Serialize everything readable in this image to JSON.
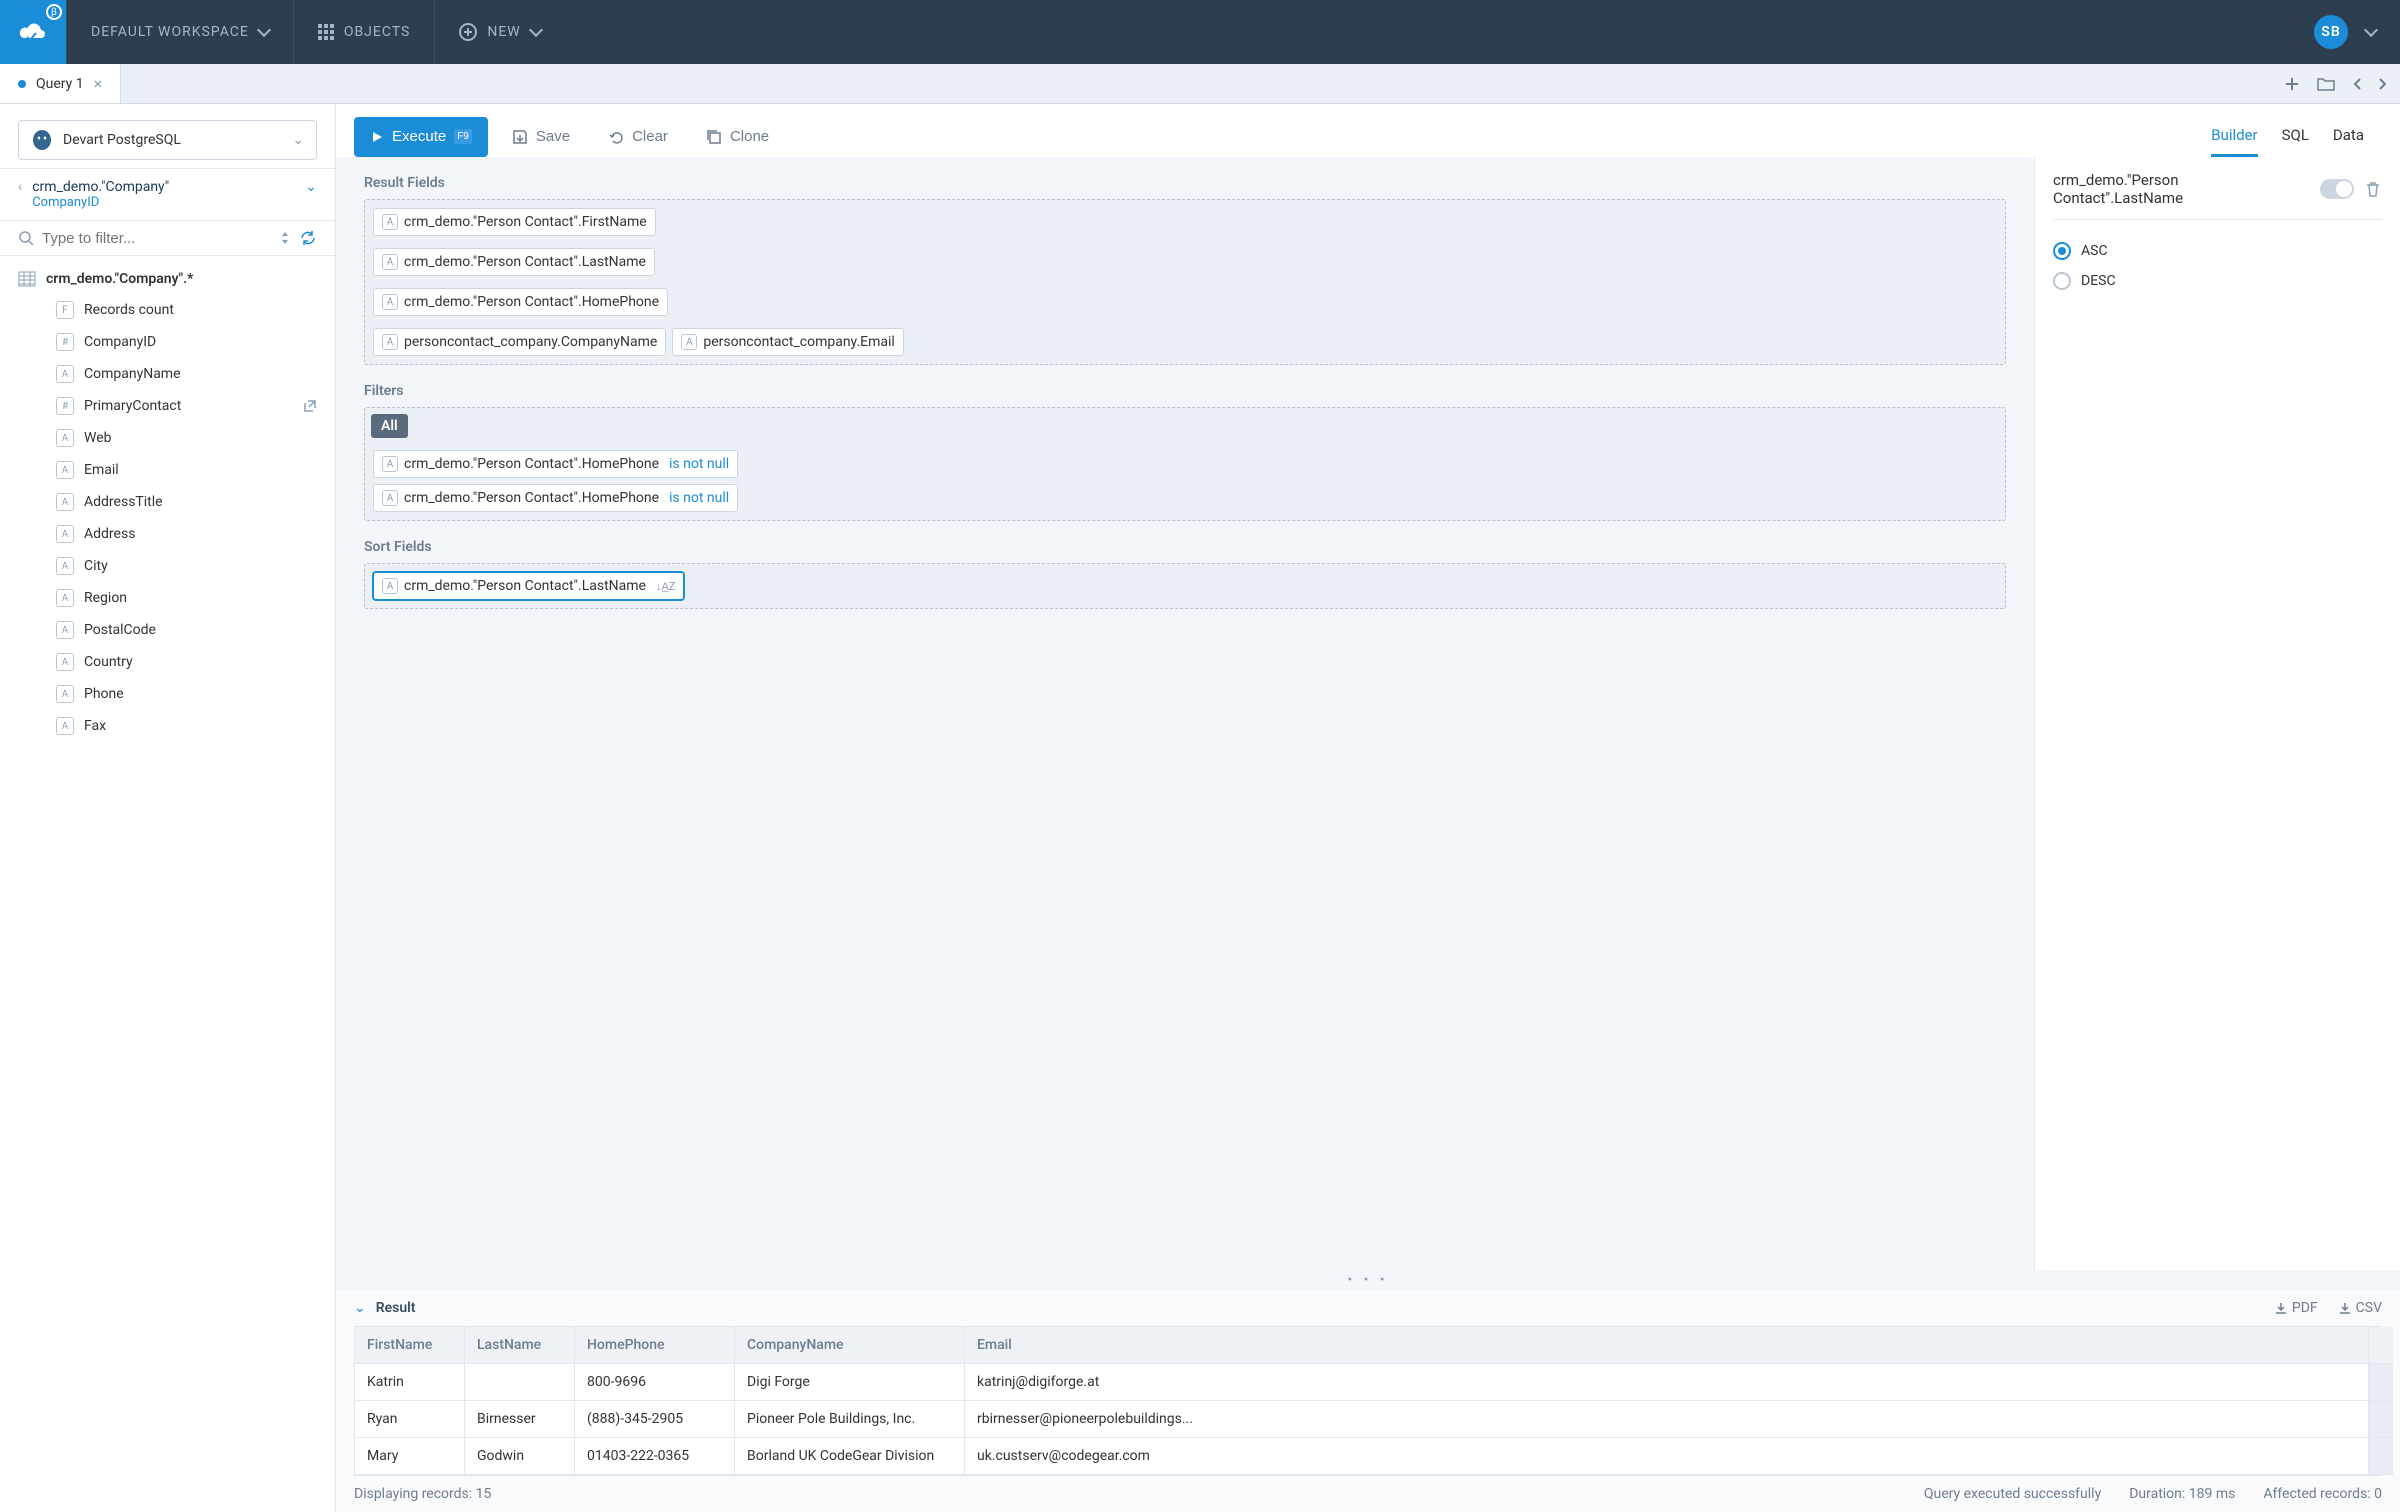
{
  "topnav": {
    "workspace": "DEFAULT WORKSPACE",
    "objects": "OBJECTS",
    "new": "NEW",
    "avatar": "SB"
  },
  "tab": {
    "label": "Query 1"
  },
  "connection": "Devart PostgreSQL",
  "toolbar": {
    "execute": "Execute",
    "execute_key": "F9",
    "save": "Save",
    "clear": "Clear",
    "clone": "Clone"
  },
  "view_tabs": {
    "builder": "Builder",
    "sql": "SQL",
    "data": "Data"
  },
  "crumb": {
    "title": "crm_demo.\"Company\"",
    "sub": "CompanyID"
  },
  "filter_placeholder": "Type to filter...",
  "tree_root": "crm_demo.\"Company\".*",
  "tree_items": [
    {
      "badge": "F",
      "label": "Records count",
      "link": false
    },
    {
      "badge": "#",
      "label": "CompanyID",
      "link": false
    },
    {
      "badge": "A",
      "label": "CompanyName",
      "link": false
    },
    {
      "badge": "#",
      "label": "PrimaryContact",
      "link": true
    },
    {
      "badge": "A",
      "label": "Web",
      "link": false
    },
    {
      "badge": "A",
      "label": "Email",
      "link": false
    },
    {
      "badge": "A",
      "label": "AddressTitle",
      "link": false
    },
    {
      "badge": "A",
      "label": "Address",
      "link": false
    },
    {
      "badge": "A",
      "label": "City",
      "link": false
    },
    {
      "badge": "A",
      "label": "Region",
      "link": false
    },
    {
      "badge": "A",
      "label": "PostalCode",
      "link": false
    },
    {
      "badge": "A",
      "label": "Country",
      "link": false
    },
    {
      "badge": "A",
      "label": "Phone",
      "link": false
    },
    {
      "badge": "A",
      "label": "Fax",
      "link": false
    }
  ],
  "builder": {
    "result_fields_label": "Result Fields",
    "result_fields": [
      "crm_demo.\"Person Contact\".FirstName",
      "crm_demo.\"Person Contact\".LastName",
      "crm_demo.\"Person Contact\".HomePhone",
      "personcontact_company.CompanyName",
      "personcontact_company.Email"
    ],
    "filters_label": "Filters",
    "filters_all": "All",
    "filters": [
      {
        "field": "crm_demo.\"Person Contact\".HomePhone",
        "op": "is not null"
      },
      {
        "field": "crm_demo.\"Person Contact\".HomePhone",
        "op": "is not null"
      }
    ],
    "sort_label": "Sort Fields",
    "sort_fields": [
      "crm_demo.\"Person Contact\".LastName"
    ]
  },
  "right_panel": {
    "title": "crm_demo.\"Person Contact\".LastName",
    "asc": "ASC",
    "desc": "DESC"
  },
  "result": {
    "label": "Result",
    "pdf": "PDF",
    "csv": "CSV",
    "columns": [
      "FirstName",
      "LastName",
      "HomePhone",
      "CompanyName",
      "Email"
    ],
    "rows": [
      [
        "Katrin",
        "",
        "800-9696",
        "Digi Forge",
        "katrinj@digiforge.at"
      ],
      [
        "Ryan",
        "Birnesser",
        "(888)-345-2905",
        "Pioneer Pole Buildings, Inc.",
        "rbirnesser@pioneerpolebuildings..."
      ],
      [
        "Mary",
        "Godwin",
        "01403-222-0365",
        "Borland UK CodeGear Division",
        "uk.custserv@codegear.com"
      ]
    ]
  },
  "status": {
    "left": "Displaying records: 15",
    "success": "Query executed successfully",
    "duration": "Duration: 189 ms",
    "affected": "Affected records: 0"
  }
}
